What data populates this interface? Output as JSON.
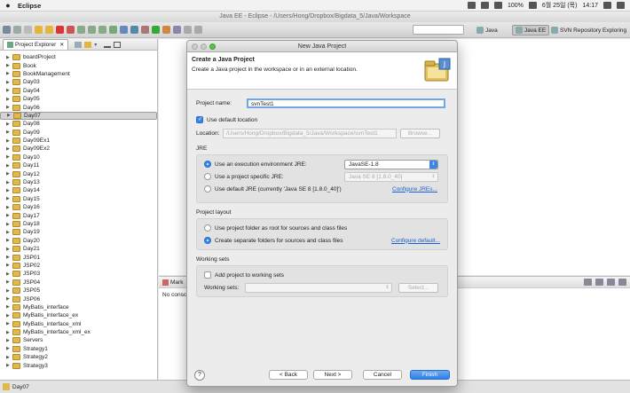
{
  "menubar": {
    "apple": "",
    "app_name": "Eclipse",
    "battery": "100%",
    "date": "6월 25일 (목)",
    "time": "14:17"
  },
  "window_title": "Java EE - Eclipse - /Users/Hong/Dropbox/Bigdata_5/Java/Workspace",
  "perspectives": {
    "java": "Java",
    "java_ee": "Java EE",
    "svn": "SVN Repository Exploring"
  },
  "explorer": {
    "tab_label": "Project Explorer",
    "items": [
      {
        "label": "boardProject"
      },
      {
        "label": "Book"
      },
      {
        "label": "BookManagement"
      },
      {
        "label": "Day03"
      },
      {
        "label": "Day04"
      },
      {
        "label": "Day05"
      },
      {
        "label": "Day06"
      },
      {
        "label": "Day07",
        "selected": true
      },
      {
        "label": "Day08"
      },
      {
        "label": "Day09"
      },
      {
        "label": "Day09Ex1"
      },
      {
        "label": "Day09Ex2"
      },
      {
        "label": "Day10"
      },
      {
        "label": "Day11"
      },
      {
        "label": "Day12"
      },
      {
        "label": "Day13"
      },
      {
        "label": "Day14"
      },
      {
        "label": "Day15"
      },
      {
        "label": "Day16"
      },
      {
        "label": "Day17"
      },
      {
        "label": "Day18"
      },
      {
        "label": "Day19"
      },
      {
        "label": "Day20"
      },
      {
        "label": "Day21"
      },
      {
        "label": "JSP01"
      },
      {
        "label": "JSP02"
      },
      {
        "label": "JSP03"
      },
      {
        "label": "JSP04"
      },
      {
        "label": "JSP05"
      },
      {
        "label": "JSP06"
      },
      {
        "label": "MyBatis_interface"
      },
      {
        "label": "MyBatis_interface_ex"
      },
      {
        "label": "MyBatis_interface_xml"
      },
      {
        "label": "MyBatis_interface_xml_ex"
      },
      {
        "label": "Servers"
      },
      {
        "label": "Strategy1"
      },
      {
        "label": "Strategy2"
      },
      {
        "label": "Strategy3"
      }
    ]
  },
  "bottom_pane": {
    "tab_label": "Mark",
    "no_console": "No consc"
  },
  "status_bar": {
    "selection": "Day07"
  },
  "dialog": {
    "title": "New Java Project",
    "header_title": "Create a Java Project",
    "header_subtitle": "Create a Java project in the workspace or in an external location.",
    "project_name_label": "Project name:",
    "project_name_value": "svnTest1",
    "use_default_location": "Use default location",
    "location_label": "Location:",
    "location_value": "/Users/Hong/Dropbox/Bigdata_5/Java/Workspace/svnTest1",
    "browse": "Browse...",
    "jre_group": "JRE",
    "jre_exec_env": "Use an execution environment JRE:",
    "jre_exec_env_value": "JavaSE-1.8",
    "jre_project_specific": "Use a project specific JRE:",
    "jre_project_specific_value": "Java SE 8 [1.8.0_40]",
    "jre_default": "Use default JRE (currently 'Java SE 8 [1.8.0_40]')",
    "configure_jres": "Configure JREs...",
    "layout_group": "Project layout",
    "layout_root": "Use project folder as root for sources and class files",
    "layout_separate": "Create separate folders for sources and class files",
    "configure_default": "Configure default...",
    "working_sets_group": "Working sets",
    "add_to_working_sets": "Add project to working sets",
    "working_sets_label": "Working sets:",
    "select": "Select...",
    "help": "?",
    "back": "< Back",
    "next": "Next >",
    "cancel": "Cancel",
    "finish": "Finish"
  }
}
